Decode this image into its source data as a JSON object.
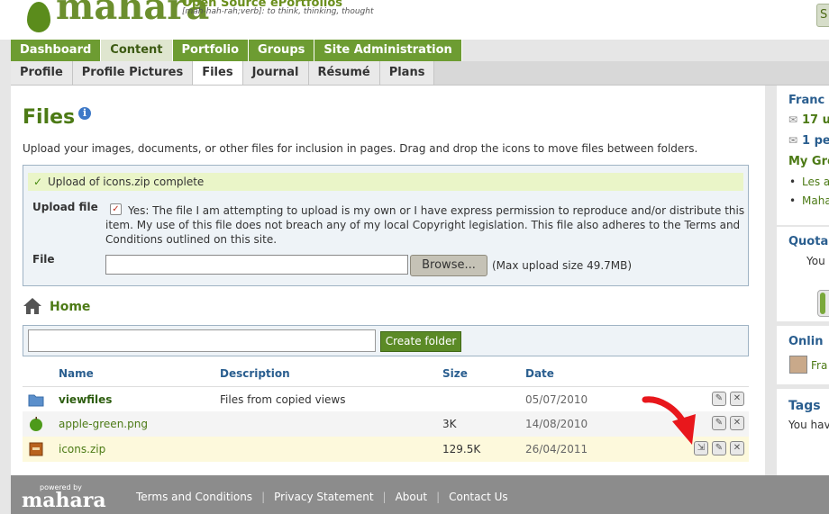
{
  "header": {
    "logo_text": "mahara",
    "tagline_main": "Open Source ePortfolios",
    "tagline_sub": "[mah-hah-rah;verb]: to think, thinking, thought",
    "search_button_label": "S"
  },
  "nav_main": [
    {
      "label": "Dashboard",
      "active": false
    },
    {
      "label": "Content",
      "active": true
    },
    {
      "label": "Portfolio",
      "active": false
    },
    {
      "label": "Groups",
      "active": false
    },
    {
      "label": "Site Administration",
      "active": false
    }
  ],
  "nav_sub": [
    {
      "label": "Profile",
      "active": false
    },
    {
      "label": "Profile Pictures",
      "active": false
    },
    {
      "label": "Files",
      "active": true
    },
    {
      "label": "Journal",
      "active": false
    },
    {
      "label": "Résumé",
      "active": false
    },
    {
      "label": "Plans",
      "active": false
    }
  ],
  "page": {
    "title": "Files",
    "info_icon": "info-icon",
    "intro": "Upload your images, documents, or other files for inclusion in pages. Drag and drop the icons to move files between folders."
  },
  "upload": {
    "success_message": "Upload of icons.zip complete",
    "upload_label": "Upload file",
    "permission_text": "Yes: The file I am attempting to upload is my own or I have express permission to reproduce and/or distribute this item. My use of this file does not breach any of my local Copyright legislation. This file also adheres to the Terms and Conditions outlined on this site.",
    "file_label": "File",
    "browse_label": "Browse...",
    "max_size": "(Max upload size 49.7MB)"
  },
  "folder": {
    "home_label": "Home",
    "create_folder_label": "Create folder",
    "input_value": ""
  },
  "table": {
    "headers": {
      "name": "Name",
      "description": "Description",
      "size": "Size",
      "date": "Date"
    },
    "rows": [
      {
        "name": "viewfiles",
        "description": "Files from copied views",
        "size": "",
        "date": "05/07/2010",
        "icon": "folder-icon"
      },
      {
        "name": "apple-green.png",
        "description": "",
        "size": "3K",
        "date": "14/08/2010",
        "icon": "image-icon"
      },
      {
        "name": "icons.zip",
        "description": "",
        "size": "129.5K",
        "date": "26/04/2011",
        "icon": "archive-icon"
      }
    ]
  },
  "sidebar": {
    "user_name": "Franc",
    "messages_unread": "17 u",
    "messages_pending": "1 pe",
    "my_groups_title": "My Gro",
    "group1": "Les a",
    "group2": "Maha",
    "quota_title": "Quota",
    "quota_text": "You",
    "online_title": "Onlin",
    "online_user": "Fra",
    "tags_title": "Tags",
    "tags_text": "You hav"
  },
  "footer": {
    "powered_by": "powered by",
    "logo_text": "mahara",
    "links": [
      "Terms and Conditions",
      "Privacy Statement",
      "About",
      "Contact Us"
    ]
  },
  "colors": {
    "brand_green": "#6d9c32",
    "link_blue": "#2a5e8f",
    "success_bg": "#eaf5c8"
  }
}
